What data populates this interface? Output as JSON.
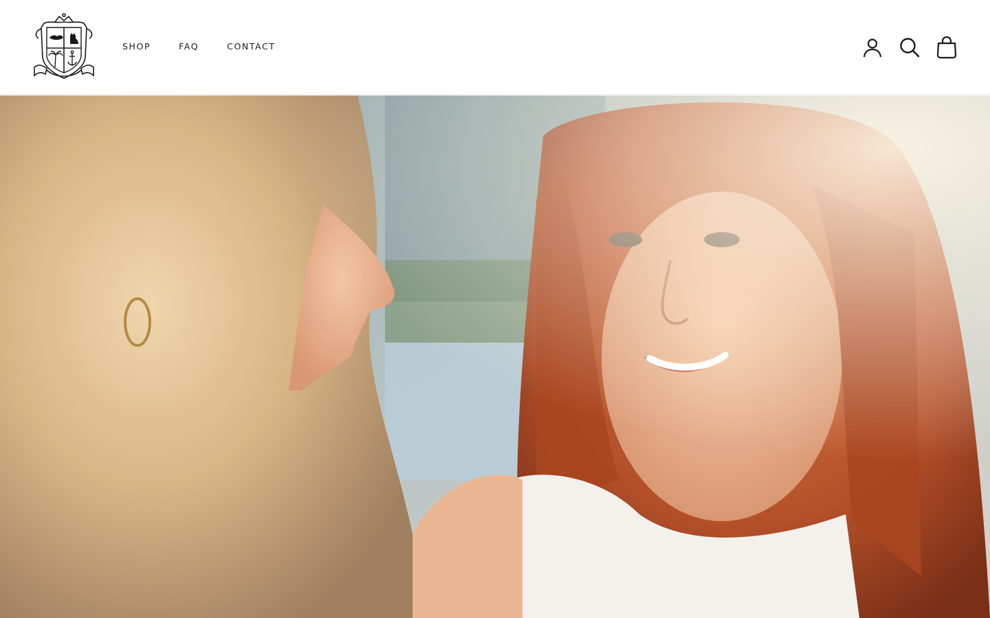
{
  "nav": {
    "items": [
      {
        "label": "SHOP"
      },
      {
        "label": "FAQ"
      },
      {
        "label": "CONTACT"
      }
    ]
  },
  "icons": {
    "account": "account-icon",
    "search": "search-icon",
    "cart": "cart-icon"
  },
  "colors": {
    "text": "#1a1a1a",
    "background": "#ffffff"
  }
}
